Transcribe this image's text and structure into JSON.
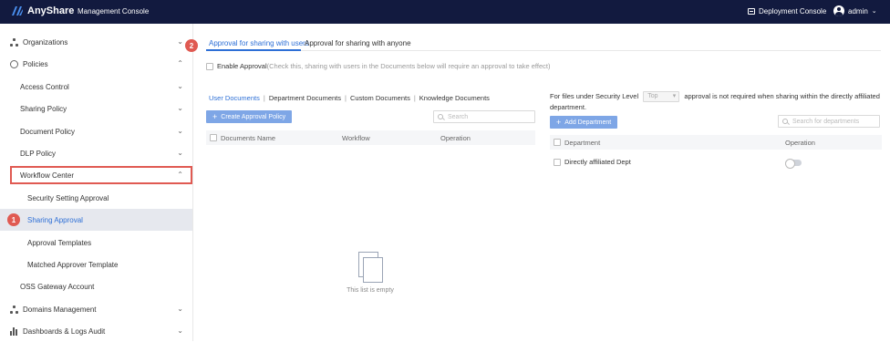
{
  "header": {
    "brand": "AnyShare",
    "console_title": "Management Console",
    "deployment_console": "Deployment Console",
    "user": "admin"
  },
  "sidebar": {
    "items": [
      {
        "label": "Organizations",
        "icon": "organizations-icon",
        "expanded": false
      },
      {
        "label": "Policies",
        "icon": "policies-icon",
        "expanded": true
      },
      {
        "label": "Access Control"
      },
      {
        "label": "Sharing Policy"
      },
      {
        "label": "Document Policy"
      },
      {
        "label": "DLP Policy"
      },
      {
        "label": "Workflow Center",
        "expanded": true
      },
      {
        "label": "Security Setting Approval"
      },
      {
        "label": "Sharing Approval",
        "active": true
      },
      {
        "label": "Approval Templates"
      },
      {
        "label": "Matched Approver Template"
      },
      {
        "label": "OSS Gateway Account"
      },
      {
        "label": "Domains Management",
        "icon": "domains-icon"
      },
      {
        "label": "Dashboards & Logs Audit",
        "icon": "dashboards-icon"
      }
    ]
  },
  "steps": {
    "one": "1",
    "two": "2"
  },
  "main": {
    "tabs": [
      "Approval for sharing with users",
      "Approval for sharing with anyone"
    ],
    "enable_label": "Enable Approval",
    "enable_hint": "(Check this, sharing with users in the Documents below will require an approval to take effect)",
    "doc_tabs": [
      "User Documents",
      "Department Documents",
      "Custom Documents",
      "Knowledge Documents"
    ],
    "create_button": "Create Approval Policy",
    "search_placeholder": "Search",
    "table_headers": [
      "Documents Name",
      "Workflow",
      "Operation"
    ],
    "empty_text": "This list is empty",
    "right": {
      "info_prefix": "For files under Security Level",
      "level_value": "Top",
      "info_suffix": "approval is not required when sharing within the directly affiliated department.",
      "add_button": "Add Department",
      "search_placeholder": "Search for departments",
      "table_headers": [
        "Department",
        "Operation"
      ],
      "rows": [
        {
          "name": "Directly affiliated Dept",
          "enabled": false
        }
      ]
    }
  },
  "colors": {
    "topbar": "#121a3f",
    "accent": "#2d6fd6",
    "highlight": "#e05a52"
  }
}
